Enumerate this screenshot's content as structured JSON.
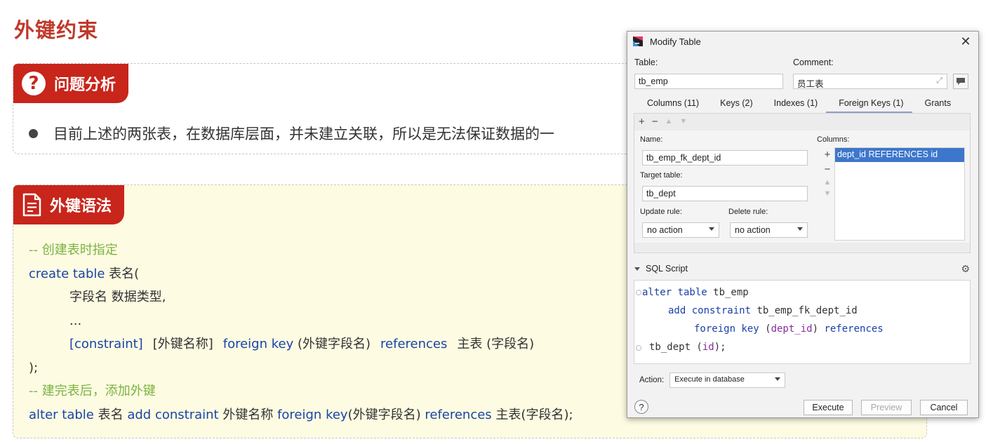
{
  "slide": {
    "title": "外键约束",
    "problem_badge": "问题分析",
    "problem_bullet": "目前上述的两张表，在数据库层面，并未建立关联，所以是无法保证数据的一",
    "syntax_badge": "外键语法",
    "code": {
      "comment1": "-- 创建表时指定",
      "create_kw": "create table",
      "create_rest": " 表名(",
      "field_line": "字段名    数据类型,",
      "ellipsis": "...",
      "constraint_kw": "[constraint]",
      "fk_name": "[外键名称]",
      "foreign_key_kw": "foreign  key",
      "fk_field": "(外键字段名)",
      "references_kw": "references",
      "main_table": "主表 (字段名)",
      "close_paren": ");",
      "comment2": "-- 建完表后，添加外键",
      "alter_kw": "alter table",
      "alter_table_name": "表名",
      "add_constraint_kw": "add constraint",
      "alter_fk_name": "外键名称",
      "alter_foreign_key_kw": "foreign key",
      "alter_fk_field": "(外键字段名)",
      "alter_references_kw": "references",
      "alter_main_table": "主表(字段名);"
    }
  },
  "dialog": {
    "title": "Modify Table",
    "table_label": "Table:",
    "table_value": "tb_emp",
    "comment_label": "Comment:",
    "comment_value": "员工表",
    "tabs": [
      {
        "label": "Columns (11)"
      },
      {
        "label": "Keys (2)"
      },
      {
        "label": "Indexes (1)"
      },
      {
        "label": "Foreign Keys (1)"
      },
      {
        "label": "Grants"
      }
    ],
    "active_tab": "Foreign Keys (1)",
    "fk": {
      "name_label": "Name:",
      "name_value": "tb_emp_fk_dept_id",
      "target_label": "Target table:",
      "target_value": "tb_dept",
      "update_label": "Update rule:",
      "update_value": "no action",
      "delete_label": "Delete rule:",
      "delete_value": "no action",
      "columns_label": "Columns:",
      "columns_item": "dept_id REFERENCES id"
    },
    "sql": {
      "header": "SQL Script",
      "l1_kw": "alter table",
      "l1_rest": " tb_emp",
      "l2_kw": "add constraint",
      "l2_rest": " tb_emp_fk_dept_id",
      "l3_kw1": "foreign key",
      "l3_open": " (",
      "l3_id": "dept_id",
      "l3_close": ") ",
      "l3_kw2": "references",
      "l4_a": "tb_dept (",
      "l4_id": "id",
      "l4_b": ");"
    },
    "action_label": "Action:",
    "action_value": "Execute in database",
    "help": "?",
    "execute": "Execute",
    "preview": "Preview",
    "cancel": "Cancel"
  }
}
